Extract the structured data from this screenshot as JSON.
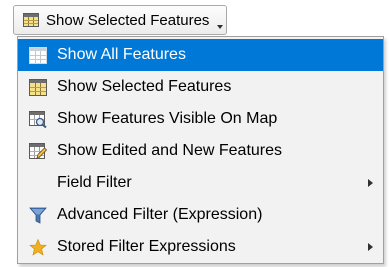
{
  "combo": {
    "label": "Show Selected Features",
    "icon": "selected-features-table-icon"
  },
  "menu": {
    "items": [
      {
        "label": "Show All Features",
        "icon": "table-all-icon",
        "selected": true,
        "has_submenu": false
      },
      {
        "label": "Show Selected Features",
        "icon": "table-selected-icon",
        "selected": false,
        "has_submenu": false
      },
      {
        "label": "Show Features Visible On Map",
        "icon": "table-visible-on-map-icon",
        "selected": false,
        "has_submenu": false
      },
      {
        "label": "Show Edited and New Features",
        "icon": "table-edited-icon",
        "selected": false,
        "has_submenu": false
      },
      {
        "label": "Field Filter",
        "icon": "",
        "selected": false,
        "has_submenu": true
      },
      {
        "label": "Advanced Filter (Expression)",
        "icon": "filter-funnel-icon",
        "selected": false,
        "has_submenu": false
      },
      {
        "label": "Stored Filter Expressions",
        "icon": "star-icon",
        "selected": false,
        "has_submenu": true
      }
    ]
  },
  "colors": {
    "highlight": "#0078d7",
    "menu_background": "#f2f2f2",
    "table_header": "#6e6e6e",
    "table_selected": "#f5d76e",
    "funnel": "#4a78b5",
    "star": "#f2b01e"
  }
}
